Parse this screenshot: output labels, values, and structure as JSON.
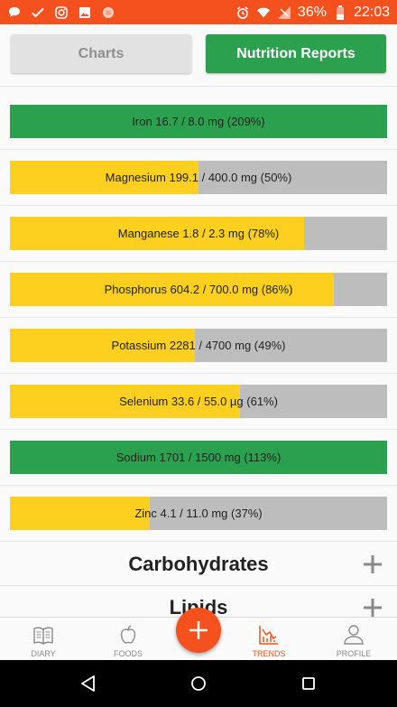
{
  "status_bar": {
    "battery": "36%",
    "time": "22:03",
    "icons": [
      "chat-bubble-icon",
      "check-icon",
      "instagram-icon",
      "image-icon",
      "record-icon",
      "alarm-icon",
      "wifi-icon",
      "signal-icon",
      "battery-icon"
    ]
  },
  "tabs": {
    "charts_label": "Charts",
    "reports_label": "Nutrition Reports"
  },
  "nutrients": [
    {
      "label": "Iron 16.7 / 8.0 mg (209%)",
      "percent": 209
    },
    {
      "label": "Magnesium 199.1 / 400.0 mg (50%)",
      "percent": 50
    },
    {
      "label": "Manganese 1.8 / 2.3 mg (78%)",
      "percent": 78
    },
    {
      "label": "Phosphorus 604.2 / 700.0 mg (86%)",
      "percent": 86
    },
    {
      "label": "Potassium 2281 / 4700 mg (49%)",
      "percent": 49
    },
    {
      "label": "Selenium 33.6 / 55.0 µg (61%)",
      "percent": 61
    },
    {
      "label": "Sodium 1701 / 1500 mg (113%)",
      "percent": 113
    },
    {
      "label": "Zinc 4.1 / 11.0 mg (37%)",
      "percent": 37
    }
  ],
  "sections": [
    {
      "title": "Carbohydrates"
    },
    {
      "title": "Lipids"
    }
  ],
  "bottom_nav": {
    "diary": "DIARY",
    "foods": "FOODS",
    "trends": "TRENDS",
    "profile": "PROFILE",
    "active": "trends"
  },
  "colors": {
    "accent": "#f4511e",
    "green": "#2ba14f",
    "yellow": "#fdd01f",
    "track": "#bdbdbd"
  }
}
